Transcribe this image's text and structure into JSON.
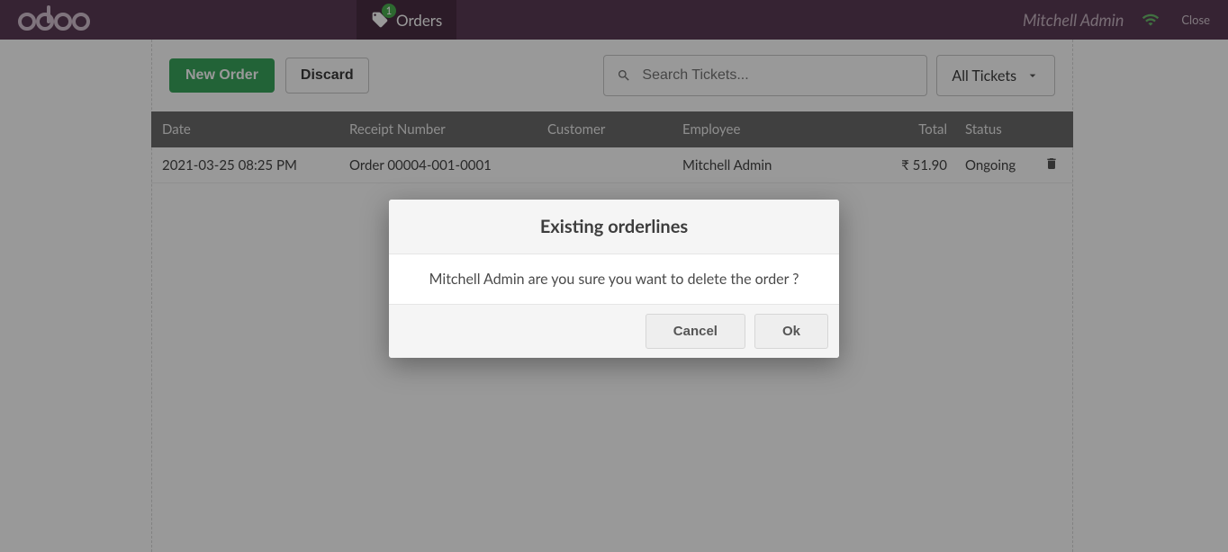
{
  "header": {
    "orders_tab_label": "Orders",
    "orders_badge": "1",
    "user_name": "Mitchell Admin",
    "close_label": "Close"
  },
  "toolbar": {
    "new_order_label": "New Order",
    "discard_label": "Discard",
    "search_placeholder": "Search Tickets...",
    "filter_label": "All Tickets"
  },
  "table": {
    "headers": {
      "date": "Date",
      "receipt": "Receipt Number",
      "customer": "Customer",
      "employee": "Employee",
      "total": "Total",
      "status": "Status"
    },
    "rows": [
      {
        "date": "2021-03-25 08:25 PM",
        "receipt": "Order 00004-001-0001",
        "customer": "",
        "employee": "Mitchell Admin",
        "total": "₹ 51.90",
        "status": "Ongoing"
      }
    ]
  },
  "modal": {
    "title": "Existing orderlines",
    "body": "Mitchell Admin are you sure you want to delete the order ?",
    "cancel_label": "Cancel",
    "ok_label": "Ok"
  }
}
